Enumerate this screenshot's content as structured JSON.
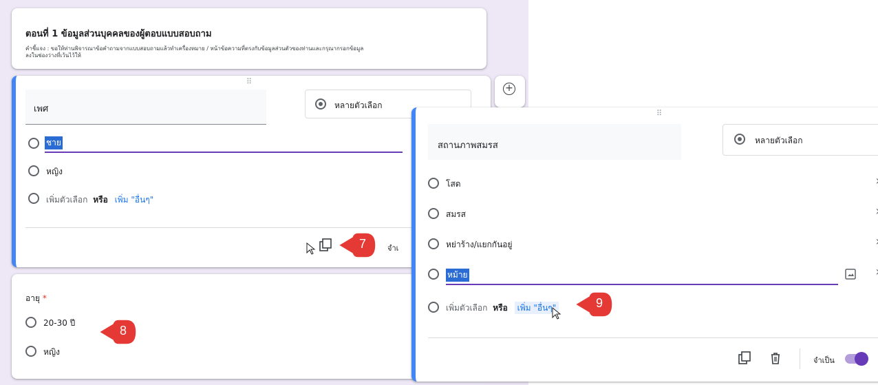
{
  "section": {
    "title": "ตอนที่ 1 ข้อมูลส่วนบุคคลของผู้ตอบแบบสอบถาม",
    "description_line1": "คำชี้แจง : ขอให้ท่านพิจารณาข้อคำถามจากแบบสอบถามแล้วทำเครื่องหมาย / หน้าข้อความที่ตรงกับข้อมูลส่วนตัวของท่านและกรุณากรอกข้อมูล",
    "description_line2": "ลงในช่องว่างที่เว้นไว้ให้"
  },
  "q_gender": {
    "title": "เพศ",
    "type_label": "หลายตัวเลือก",
    "options": [
      "ชาย",
      "หญิง"
    ],
    "add_option": "เพิ่มตัวเลือก",
    "or": "หรือ",
    "add_other": "เพิ่ม \"อื่นๆ\"",
    "required_label_partial": "จำเ"
  },
  "q_age": {
    "title": "อายุ",
    "required_mark": "*",
    "options": [
      "20-30 ปี",
      "หญิง"
    ]
  },
  "q_marital": {
    "title": "สถานภาพสมรส",
    "type_label": "หลายตัวเลือก",
    "options": [
      "โสด",
      "สมรส",
      "หย่าร้าง/แยกกันอยู่",
      "หม้าย"
    ],
    "add_option": "เพิ่มตัวเลือก",
    "or": "หรือ",
    "add_other": "เพิ่ม \"อื่นๆ\"",
    "required_label": "จำเป็น"
  },
  "callouts": [
    "7",
    "8",
    "9"
  ],
  "colors": {
    "accent": "#673ab7",
    "blue": "#4285f4",
    "callout": "#e53935",
    "selection": "#2b6cd4"
  }
}
